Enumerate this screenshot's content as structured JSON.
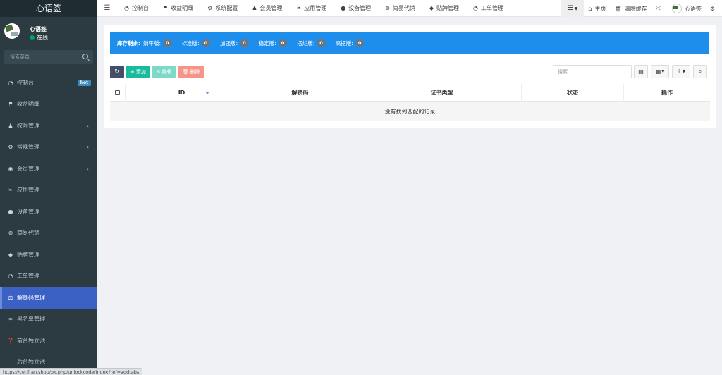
{
  "app": {
    "logo": "心语签"
  },
  "user": {
    "name": "心语签",
    "status": "在线"
  },
  "sidebar": {
    "search_placeholder": "搜索菜单",
    "items": [
      {
        "label": "控制台",
        "icon": "dashboard-icon",
        "badge": "hot"
      },
      {
        "label": "收益明细",
        "icon": "flag-icon"
      },
      {
        "label": "权限管理",
        "icon": "users-icon",
        "has_children": true
      },
      {
        "label": "常规管理",
        "icon": "cogs-icon",
        "has_children": true
      },
      {
        "label": "会员管理",
        "icon": "user-circle-icon",
        "has_children": true
      },
      {
        "label": "应用管理",
        "icon": "leaf-icon"
      },
      {
        "label": "设备管理",
        "icon": "circle-icon"
      },
      {
        "label": "简易代销",
        "icon": "record-icon"
      },
      {
        "label": "贴牌管理",
        "icon": "tags-icon"
      },
      {
        "label": "工单管理",
        "icon": "dashboard-icon"
      },
      {
        "label": "解锁码管理",
        "icon": "balance-scale-icon",
        "active": true
      },
      {
        "label": "黑名单管理",
        "icon": "binoculars-icon"
      },
      {
        "label": "前台独立池",
        "icon": "question-circle-icon"
      },
      {
        "label": "后台独立池",
        "icon": "apple-icon"
      }
    ]
  },
  "topnav": {
    "items": [
      {
        "label": "控制台",
        "icon": "dashboard-icon"
      },
      {
        "label": "收益明细",
        "icon": "flag-icon"
      },
      {
        "label": "系统配置",
        "icon": "gear-icon"
      },
      {
        "label": "会员管理",
        "icon": "users-icon"
      },
      {
        "label": "应用管理",
        "icon": "leaf-icon"
      },
      {
        "label": "设备管理",
        "icon": "circle-icon"
      },
      {
        "label": "简易代销",
        "icon": "record-icon"
      },
      {
        "label": "贴牌管理",
        "icon": "tag-icon"
      },
      {
        "label": "工单管理",
        "icon": "dashboard-icon"
      }
    ],
    "home": "主页",
    "clear_cache": "清除缓存",
    "user_name": "心语签"
  },
  "stock": {
    "lead": "库存剩余:",
    "items": [
      {
        "label": "躺平版:",
        "count": "0"
      },
      {
        "label": "标准版:",
        "count": "0"
      },
      {
        "label": "加强版:",
        "count": "0"
      },
      {
        "label": "稳定版:",
        "count": "0"
      },
      {
        "label": "摆烂版:",
        "count": "0"
      },
      {
        "label": "高摆版:",
        "count": "0"
      }
    ]
  },
  "toolbar": {
    "add": "添加",
    "edit": "编辑",
    "delete": "删除"
  },
  "search": {
    "placeholder": "搜索"
  },
  "table": {
    "columns": [
      "ID",
      "解锁码",
      "证书类型",
      "状态",
      "操作"
    ],
    "empty_text": "没有找到匹配的记录"
  },
  "statusbar": {
    "url": "https://cer.fran.shop/ok.php/unlockcode/index?ref=addtabs"
  },
  "colors": {
    "sidebar_bg": "#2c3b41",
    "active": "#3c61c4",
    "stock_bar": "#1e8eed",
    "add": "#18bc9c",
    "delete": "#f79488"
  }
}
